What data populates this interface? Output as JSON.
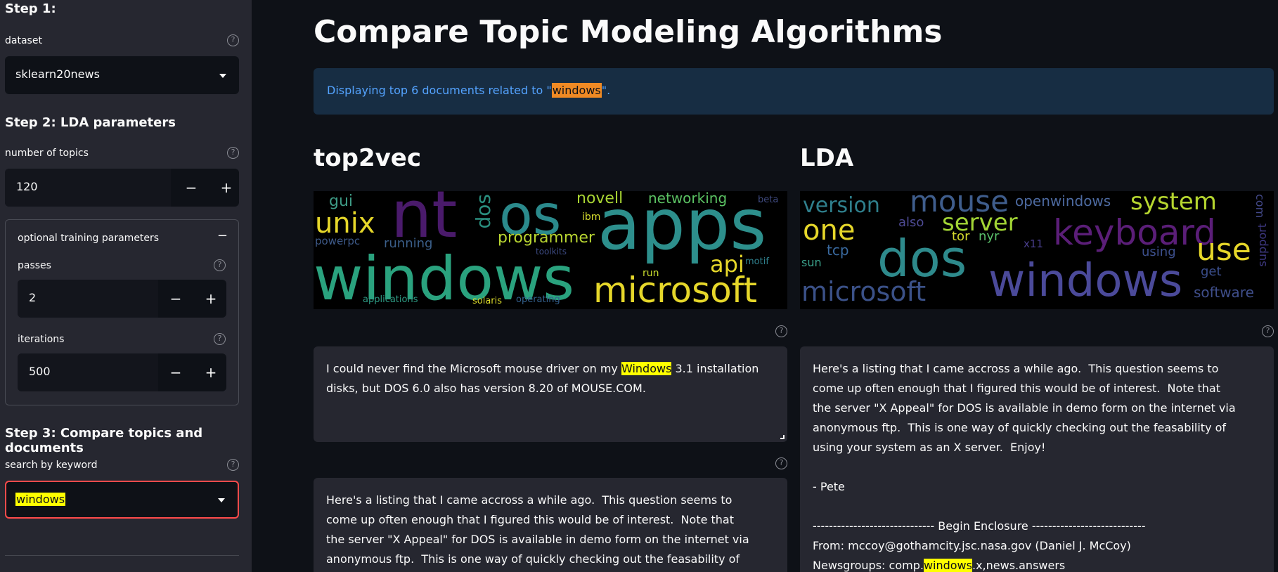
{
  "sidebar": {
    "step1": "Step 1:",
    "dataset_label": "dataset",
    "dataset_value": "sklearn20news",
    "step2": "Step 2: LDA parameters",
    "num_topics_label": "number of topics",
    "num_topics_value": "120",
    "expander_title": "optional training parameters",
    "expander_toggle": "−",
    "passes_label": "passes",
    "passes_value": "2",
    "iterations_label": "iterations",
    "iterations_value": "500",
    "step3": "Step 3: Compare topics and documents",
    "keyword_label": "search by keyword",
    "keyword_value": "windows",
    "minus": "−",
    "plus": "+",
    "help": "?"
  },
  "main": {
    "title": "Compare Topic Modeling Algorithms",
    "info_prefix": "Displaying top 6 documents related to \"",
    "info_keyword": "windows",
    "info_suffix": "\".",
    "left_title": "top2vec",
    "right_title": "LDA"
  },
  "wordclouds": {
    "top2vec": [
      {
        "w": "windows",
        "c": "#2aa27e"
      },
      {
        "w": "apps",
        "c": "#2d8f8c"
      },
      {
        "w": "os",
        "c": "#2b8a8c"
      },
      {
        "w": "nt",
        "c": "#4a1a6b"
      },
      {
        "w": "microsoft",
        "c": "#e6d72a"
      },
      {
        "w": "unix",
        "c": "#e6d72a"
      },
      {
        "w": "dos",
        "c": "#2a8f7f"
      },
      {
        "w": "programmer",
        "c": "#b8d531"
      },
      {
        "w": "api",
        "c": "#e6d72a"
      },
      {
        "w": "novell",
        "c": "#a9d533"
      },
      {
        "w": "networking",
        "c": "#5bc263"
      },
      {
        "w": "gui",
        "c": "#3e9b86"
      },
      {
        "w": "running",
        "c": "#3b5f8a"
      },
      {
        "w": "powerpc",
        "c": "#3e5a8a"
      },
      {
        "w": "ibm",
        "c": "#d6dd2e"
      },
      {
        "w": "beta",
        "c": "#3f4a7f"
      },
      {
        "w": "toolkits",
        "c": "#3c4a82"
      },
      {
        "w": "motif",
        "c": "#2f7f8c"
      },
      {
        "w": "run",
        "c": "#c8dc2e"
      },
      {
        "w": "applications",
        "c": "#2e9b84"
      },
      {
        "w": "solaris",
        "c": "#d9d82a"
      },
      {
        "w": "operating",
        "c": "#34608d"
      }
    ],
    "lda": [
      {
        "w": "windows",
        "c": "#4b4a9a"
      },
      {
        "w": "dos",
        "c": "#2e8a8c"
      },
      {
        "w": "keyboard",
        "c": "#5b1e78"
      },
      {
        "w": "mouse",
        "c": "#3f5d8c"
      },
      {
        "w": "microsoft",
        "c": "#3b5188"
      },
      {
        "w": "version",
        "c": "#2f7f8c"
      },
      {
        "w": "one",
        "c": "#e6d72a"
      },
      {
        "w": "server",
        "c": "#a2d535"
      },
      {
        "w": "system",
        "c": "#b6d62f"
      },
      {
        "w": "use",
        "c": "#e6d72a"
      },
      {
        "w": "openwindows",
        "c": "#4d6aa0"
      },
      {
        "w": "also",
        "c": "#4e4b95"
      },
      {
        "w": "tor",
        "c": "#d6dc2e"
      },
      {
        "w": "nyr",
        "c": "#5ac06a"
      },
      {
        "w": "tcp",
        "c": "#3a6aa0"
      },
      {
        "w": "x11",
        "c": "#4a3f8f"
      },
      {
        "w": "sun",
        "c": "#3aa08a"
      },
      {
        "w": "using",
        "c": "#3c4f8c"
      },
      {
        "w": "get",
        "c": "#3a4d8a"
      },
      {
        "w": "software",
        "c": "#3f4e8a"
      },
      {
        "w": "com",
        "c": "#43498a"
      },
      {
        "w": "support",
        "c": "#3f3a84"
      }
    ]
  },
  "docs": {
    "left1": {
      "before": "I could never find the Microsoft mouse driver on my ",
      "kw": "Windows",
      "after": " 3.1 installation\ndisks, but DOS 6.0 also has version 8.20 of MOUSE.COM."
    },
    "left2": "Here's a listing that I came accross a while ago.  This question seems to\ncome up often enough that I figured this would be of interest.  Note that\nthe server \"X Appeal\" for DOS is available in demo form on the internet via\nanonymous ftp.  This is one way of quickly checking out the feasability of",
    "right1": {
      "before": "Here's a listing that I came accross a while ago.  This question seems to\ncome up often enough that I figured this would be of interest.  Note that\nthe server \"X Appeal\" for DOS is available in demo form on the internet via\nanonymous ftp.  This is one way of quickly checking out the feasability of\nusing your system as an X server.  Enjoy!\n\n- Pete\n\n------------------------------ Begin Enclosure ----------------------------\nFrom: mccoy@gothamcity.jsc.nasa.gov (Daniel J. McCoy)\nNewsgroups: comp.",
      "kw": "windows",
      "after": ".x,news.answers"
    }
  },
  "colors": {
    "sidebar_bg": "#262730",
    "main_bg": "#0e1117",
    "info_bg": "#172d43",
    "info_text": "#54a3ff",
    "highlight_orange": "#f08a24",
    "highlight_yellow": "#ffff00",
    "focus_red": "#ff4b4b"
  }
}
